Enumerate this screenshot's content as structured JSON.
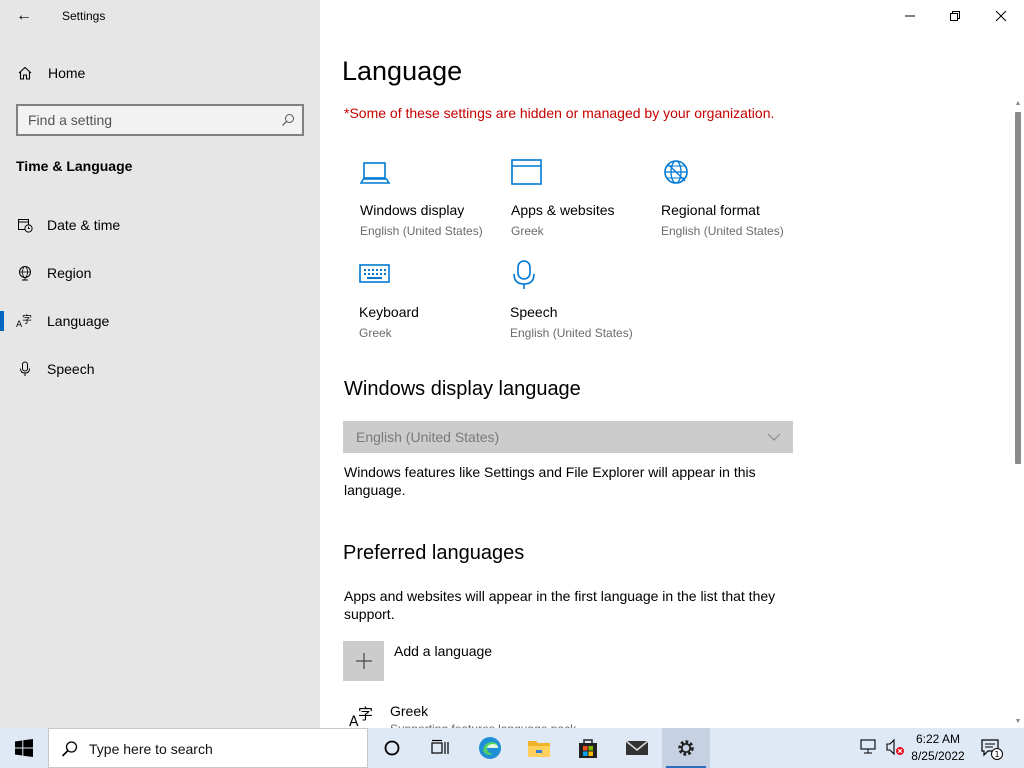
{
  "window": {
    "app_title": "Settings",
    "back_label": "←"
  },
  "sidebar": {
    "home_label": "Home",
    "search_placeholder": "Find a setting",
    "section_heading": "Time & Language",
    "items": [
      {
        "label": "Date & time",
        "icon": "calendar-clock-icon"
      },
      {
        "label": "Region",
        "icon": "globe-icon"
      },
      {
        "label": "Language",
        "icon": "language-icon",
        "selected": true
      },
      {
        "label": "Speech",
        "icon": "microphone-icon"
      }
    ]
  },
  "main": {
    "title": "Language",
    "org_notice": "*Some of these settings are hidden or managed by your organization.",
    "tiles": [
      {
        "name": "Windows display",
        "sub": "English (United States)",
        "icon": "laptop-icon"
      },
      {
        "name": "Apps & websites",
        "sub": "Greek",
        "icon": "browser-window-icon"
      },
      {
        "name": "Regional format",
        "sub": "English (United States)",
        "icon": "globe-icon"
      },
      {
        "name": "Keyboard",
        "sub": "Greek",
        "icon": "keyboard-icon"
      },
      {
        "name": "Speech",
        "sub": "English (United States)",
        "icon": "microphone-icon"
      }
    ],
    "display_language": {
      "heading": "Windows display language",
      "dropdown_value": "English (United States)",
      "description": "Windows features like Settings and File Explorer will appear in this language."
    },
    "preferred": {
      "heading": "Preferred languages",
      "description": "Apps and websites will appear in the first language in the list that they support.",
      "add_label": "Add a language",
      "languages": [
        {
          "name": "Greek",
          "sub": "Supporting features language pack"
        }
      ]
    }
  },
  "taskbar": {
    "search_placeholder": "Type here to search",
    "time": "6:22 AM",
    "date": "8/25/2022",
    "notification_count": "1"
  },
  "colors": {
    "accent": "#0067c0",
    "notice_red": "#c50000",
    "icon_blue": "#0078d4"
  }
}
